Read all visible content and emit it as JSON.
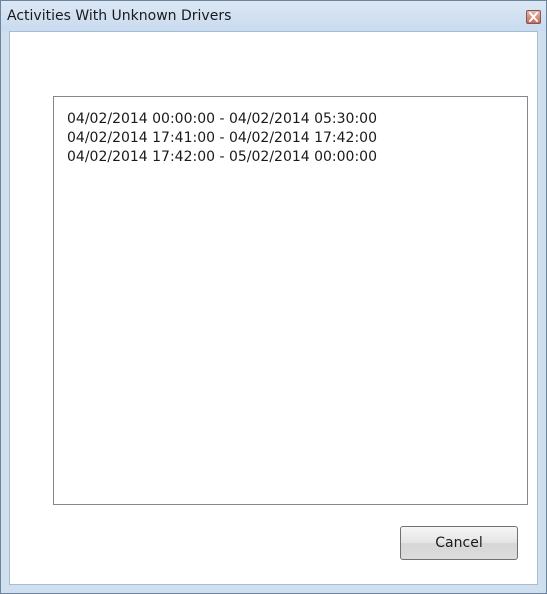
{
  "window": {
    "title": "Activities With Unknown Drivers",
    "close_icon": "close-icon"
  },
  "list": {
    "items": [
      "04/02/2014 00:00:00 - 04/02/2014 05:30:00",
      "04/02/2014 17:41:00 - 04/02/2014 17:42:00",
      "04/02/2014 17:42:00 - 05/02/2014 00:00:00"
    ]
  },
  "buttons": {
    "cancel_label": "Cancel"
  },
  "colors": {
    "frame": "#cfdff0",
    "close_button": "#c46a56"
  }
}
